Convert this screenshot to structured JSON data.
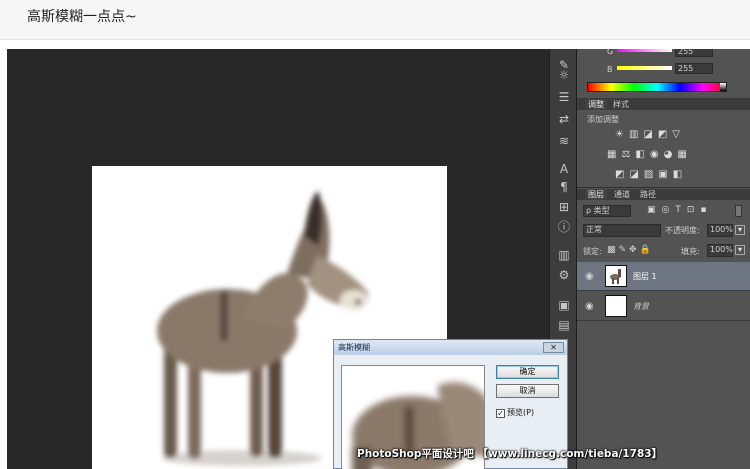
{
  "post": {
    "caption": "高斯模糊一点点~"
  },
  "color_panel": {
    "g_label": "G",
    "g_value": "255",
    "b_label": "B",
    "b_value": "255"
  },
  "adjust_panel": {
    "tab_adjust": "调整",
    "tab_styles": "样式",
    "add_adjustment": "添加调整"
  },
  "layers_panel": {
    "tab_layers": "图层",
    "tab_channels": "通道",
    "tab_paths": "路径",
    "filter_kind": "ρ 类型",
    "blend_mode": "正常",
    "opacity_label": "不透明度:",
    "opacity_value": "100%",
    "lock_label": "锁定:",
    "fill_label": "填充:",
    "fill_value": "100%",
    "layers": [
      {
        "name": "图层 1",
        "selected": true
      },
      {
        "name": "背景",
        "selected": false
      }
    ]
  },
  "dialog": {
    "title": "高斯模糊",
    "close": "✕",
    "ok": "确定",
    "cancel": "取消",
    "preview_label": "预览(P)",
    "preview_checked": "✓"
  },
  "watermark": "PhotoShop平面设计吧 【www.linecg.com/tieba/1783】",
  "colors": {
    "workspace": "#282828",
    "panel": "#535353",
    "selected_layer": "#6d7583",
    "dialog_title": "#b9cde6"
  },
  "icons": [
    "eyedropper-icon",
    "adjust-brightness-icon",
    "curves-icon",
    "exposure-icon",
    "visibility-eye-icon",
    "lock-transparency-icon",
    "lock-pixels-icon",
    "lock-position-icon",
    "lock-all-icon",
    "text-icon",
    "paragraph-icon",
    "info-icon",
    "checkbox-icon"
  ]
}
